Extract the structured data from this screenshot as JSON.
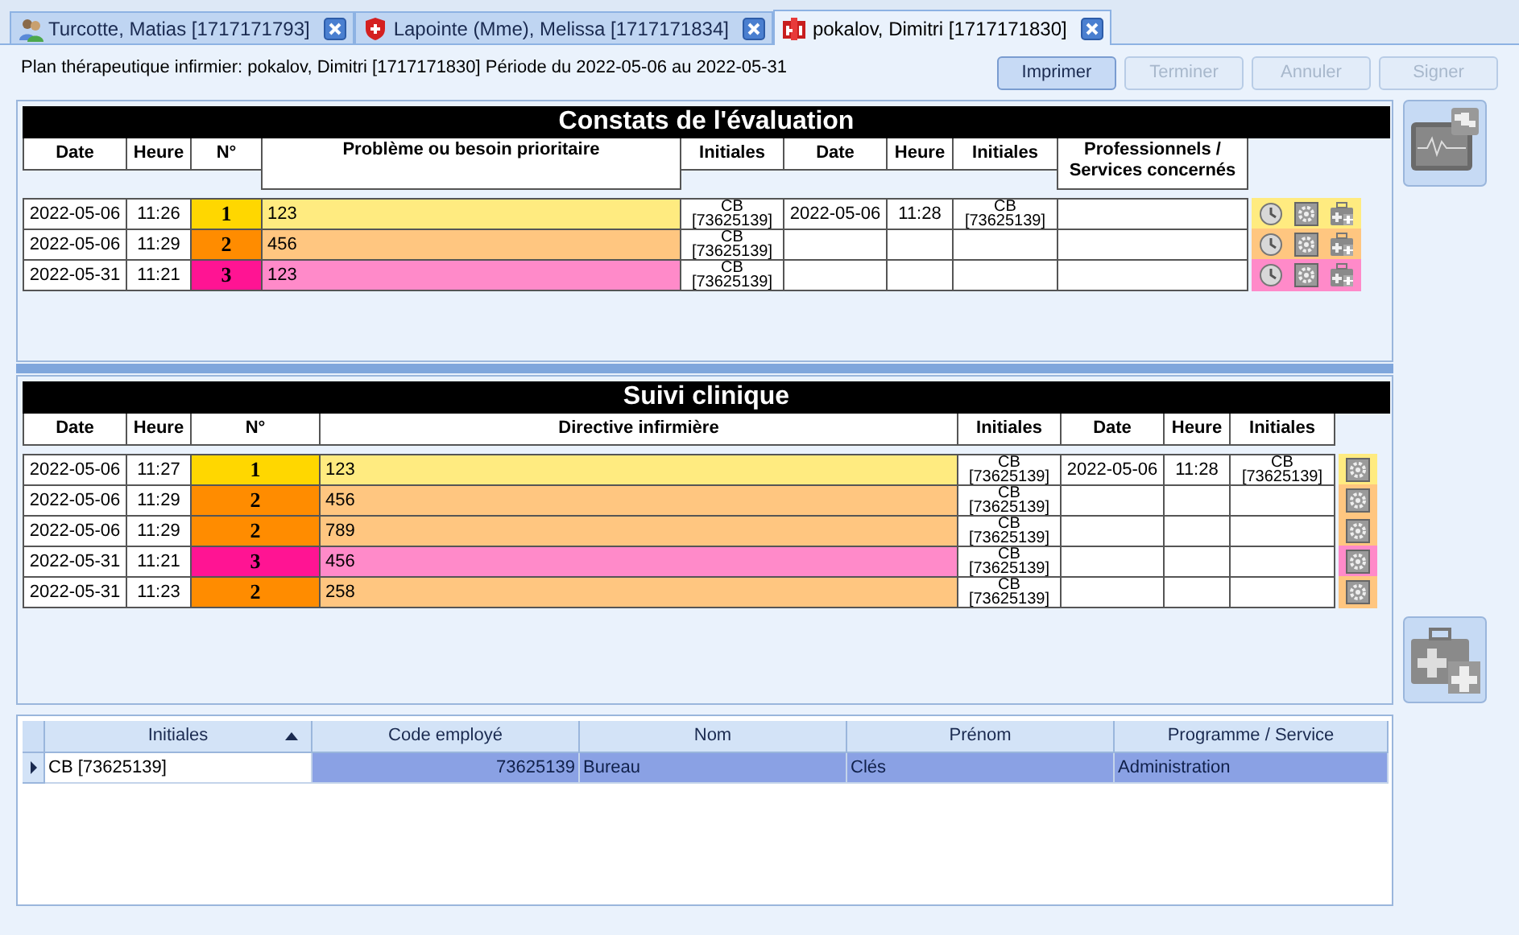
{
  "tabs": [
    {
      "label": "Turcotte, Matias [1717171793]",
      "kind": "people",
      "selected": false
    },
    {
      "label": "Lapointe (Mme), Melissa [1717171834]",
      "kind": "shield",
      "selected": false
    },
    {
      "label": "pokalov, Dimitri [1717171830]",
      "kind": "hospital",
      "selected": true
    }
  ],
  "header": "Plan thérapeutique infirmier: pokalov, Dimitri [1717171830] Période du 2022-05-06 au 2022-05-31",
  "buttons": [
    {
      "label": "Imprimer",
      "disabled": false
    },
    {
      "label": "Terminer",
      "disabled": true
    },
    {
      "label": "Annuler",
      "disabled": true
    },
    {
      "label": "Signer",
      "disabled": true
    }
  ],
  "evaluation": {
    "title": "Constats de l'évaluation",
    "columns": [
      "Date",
      "Heure",
      "N°",
      "Problème ou besoin prioritaire",
      "Initiales",
      "Date",
      "Heure",
      "Initiales",
      "Professionnels / Services concernés"
    ],
    "rows": [
      {
        "date": "2022-05-06",
        "time": "11:26",
        "number": "1",
        "color": "#ffd700",
        "text": "123",
        "initials": "CB [73625139]",
        "date_2": "2022-05-06",
        "time_2": "11:28",
        "initials_2": "CB [73625139]"
      },
      {
        "date": "2022-05-06",
        "time": "11:29",
        "number": "2",
        "color": "#ff8c00",
        "text": "456",
        "initials": "CB [73625139]"
      },
      {
        "date": "2022-05-31",
        "time": "11:21",
        "number": "3",
        "color": "#ff1493",
        "text": "123",
        "initials": "CB [73625139]"
      }
    ]
  },
  "follow_up": {
    "title": "Suivi clinique",
    "columns": [
      "Date",
      "Heure",
      "N°",
      "Directive infirmière",
      "Initiales",
      "Date",
      "Heure",
      "Initiales"
    ],
    "rows": [
      {
        "date": "2022-05-06",
        "time": "11:27",
        "number": "1",
        "color": "#ffd700",
        "text": "123",
        "initials": "CB [73625139]",
        "date_2": "2022-05-06",
        "time_2": "11:28",
        "initials_2": "CB [73625139]"
      },
      {
        "date": "2022-05-06",
        "time": "11:29",
        "number": "2",
        "color": "#ff8c00",
        "text": "456",
        "initials": "CB [73625139]"
      },
      {
        "date": "2022-05-06",
        "time": "11:29",
        "number": "2",
        "color": "#ff8c00",
        "text": "789",
        "initials": "CB [73625139]"
      },
      {
        "date": "2022-05-31",
        "time": "11:21",
        "number": "3",
        "color": "#ff1493",
        "text": "456",
        "initials": "CB [73625139]"
      },
      {
        "date": "2022-05-31",
        "time": "11:23",
        "number": "2",
        "color": "#ff8c00",
        "text": "258",
        "initials": "CB [73625139]"
      }
    ]
  },
  "staff_table": {
    "columns": [
      {
        "label": "Initiales",
        "sorted": true
      },
      {
        "label": "Code employé",
        "sorted": false
      },
      {
        "label": "Nom",
        "sorted": false
      },
      {
        "label": "Prénom",
        "sorted": false
      },
      {
        "label": "Programme / Service",
        "sorted": false
      }
    ],
    "rows": [
      {
        "selected": true,
        "cells": [
          "CB [73625139]",
          "73625139",
          "Bureau",
          "Clés",
          "Administration"
        ]
      }
    ]
  }
}
